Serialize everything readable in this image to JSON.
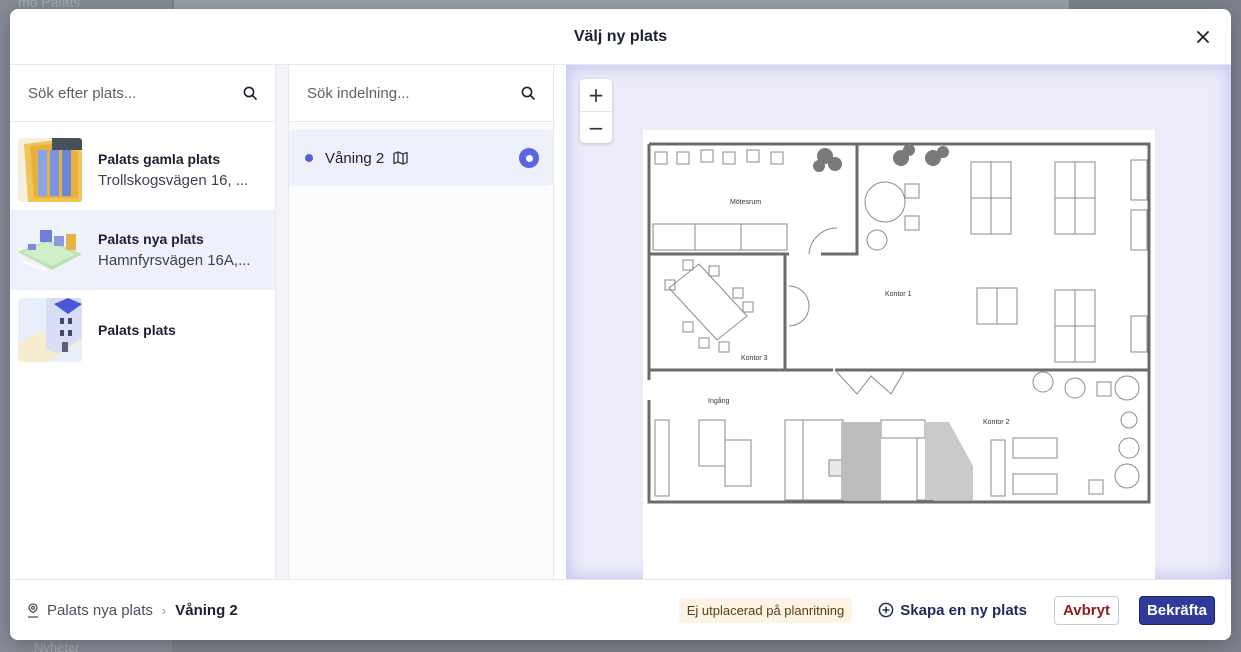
{
  "background": {
    "top_text": "mo Palats",
    "bottom_text": "Nyheter"
  },
  "modal": {
    "title": "Välj ny plats",
    "close_icon": "close-icon"
  },
  "places": {
    "search_placeholder": "Sök efter plats...",
    "items": [
      {
        "name": "Palats gamla plats",
        "address": "Trollskogsvägen 16, ...",
        "selected": false
      },
      {
        "name": "Palats nya plats",
        "address": "Hamnfyrsvägen 16A,...",
        "selected": true
      },
      {
        "name": "Palats plats",
        "address": "",
        "selected": false
      }
    ]
  },
  "floors": {
    "search_placeholder": "Sök indelning...",
    "items": [
      {
        "label": "Våning 2",
        "selected": true
      }
    ]
  },
  "map": {
    "zoom_in": "+",
    "zoom_out": "−",
    "rooms": {
      "motesrum": "Mötesrum",
      "kontor1": "Kontor 1",
      "kontor3": "Kontor 3",
      "ingang": "Ingång",
      "kontor2": "Kontor 2"
    }
  },
  "footer": {
    "crumb_place": "Palats nya plats",
    "crumb_separator": "›",
    "crumb_floor": "Våning 2",
    "badge": "Ej utplacerad på planritning",
    "create_label": "Skapa en ny plats",
    "cancel_label": "Avbryt",
    "confirm_label": "Bekräfta"
  },
  "colors": {
    "accent": "#5a66e0",
    "confirm_bg": "#2f3a99",
    "selected_bg": "#eef0fb",
    "badge_bg": "#fdf3e4",
    "cancel_text": "#8b1d1d"
  }
}
